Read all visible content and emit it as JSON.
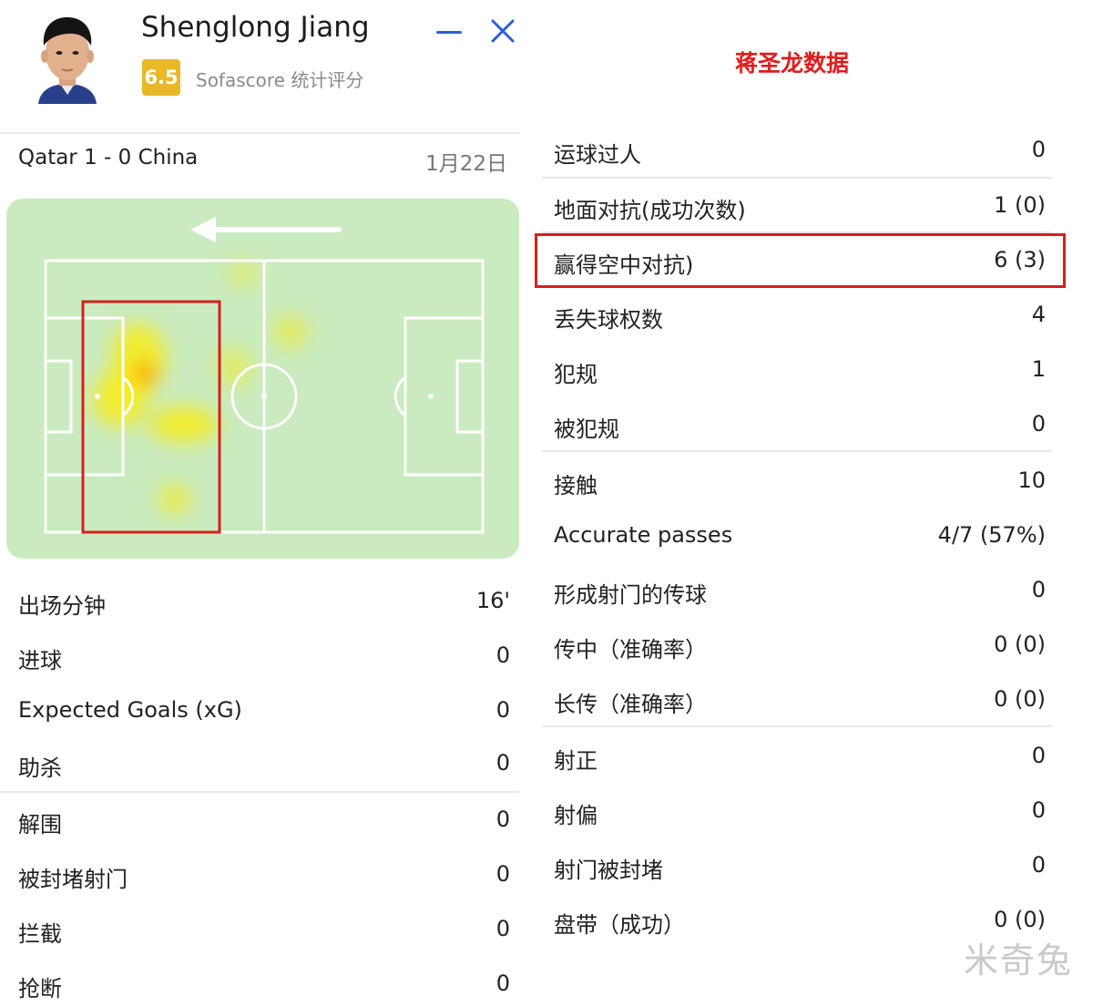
{
  "player": {
    "name": "Shenglong Jiang",
    "rating": "6.5",
    "rating_source": "Sofascore 统计评分"
  },
  "match": {
    "title": "Qatar 1 - 0 China",
    "date": "1月22日"
  },
  "colors": {
    "rating_badge": "#e8b827",
    "accent_blue": "#2f5cd3",
    "pitch_green": "#c9ebbf",
    "highlight_red": "#d51f1f",
    "title_red": "#e21b1b"
  },
  "icons": {
    "minimize": "minus-icon",
    "close": "close-icon",
    "direction": "arrow-left-icon"
  },
  "left_stats": [
    {
      "label": "出场分钟",
      "value": "16'"
    },
    {
      "label": "进球",
      "value": "0"
    },
    {
      "label": "Expected Goals (xG)",
      "value": "0"
    },
    {
      "label": "助杀",
      "value": "0"
    },
    {
      "label": "解围",
      "value": "0"
    },
    {
      "label": "被封堵射门",
      "value": "0"
    },
    {
      "label": "拦截",
      "value": "0"
    },
    {
      "label": "抢断",
      "value": "0"
    }
  ],
  "right_panel": {
    "title": "蒋圣龙数据",
    "stats": [
      {
        "label": "运球过人",
        "value": "0"
      },
      {
        "label": "地面对抗(成功次数)",
        "value": "1 (0)"
      },
      {
        "label": "赢得空中对抗)",
        "value": "6 (3)"
      },
      {
        "label": "丢失球权数",
        "value": "4"
      },
      {
        "label": "犯规",
        "value": "1"
      },
      {
        "label": "被犯规",
        "value": "0"
      },
      {
        "label": "接触",
        "value": "10"
      },
      {
        "label": "Accurate passes",
        "value": "4/7 (57%)"
      },
      {
        "label": "形成射门的传球",
        "value": "0"
      },
      {
        "label": "传中（准确率）",
        "value": "0 (0)"
      },
      {
        "label": "长传（准确率）",
        "value": "0 (0)"
      },
      {
        "label": "射正",
        "value": "0"
      },
      {
        "label": "射偏",
        "value": "0"
      },
      {
        "label": "射门被封堵",
        "value": "0"
      },
      {
        "label": "盘带（成功）",
        "value": "0 (0)"
      }
    ]
  },
  "watermark": "米奇兔"
}
